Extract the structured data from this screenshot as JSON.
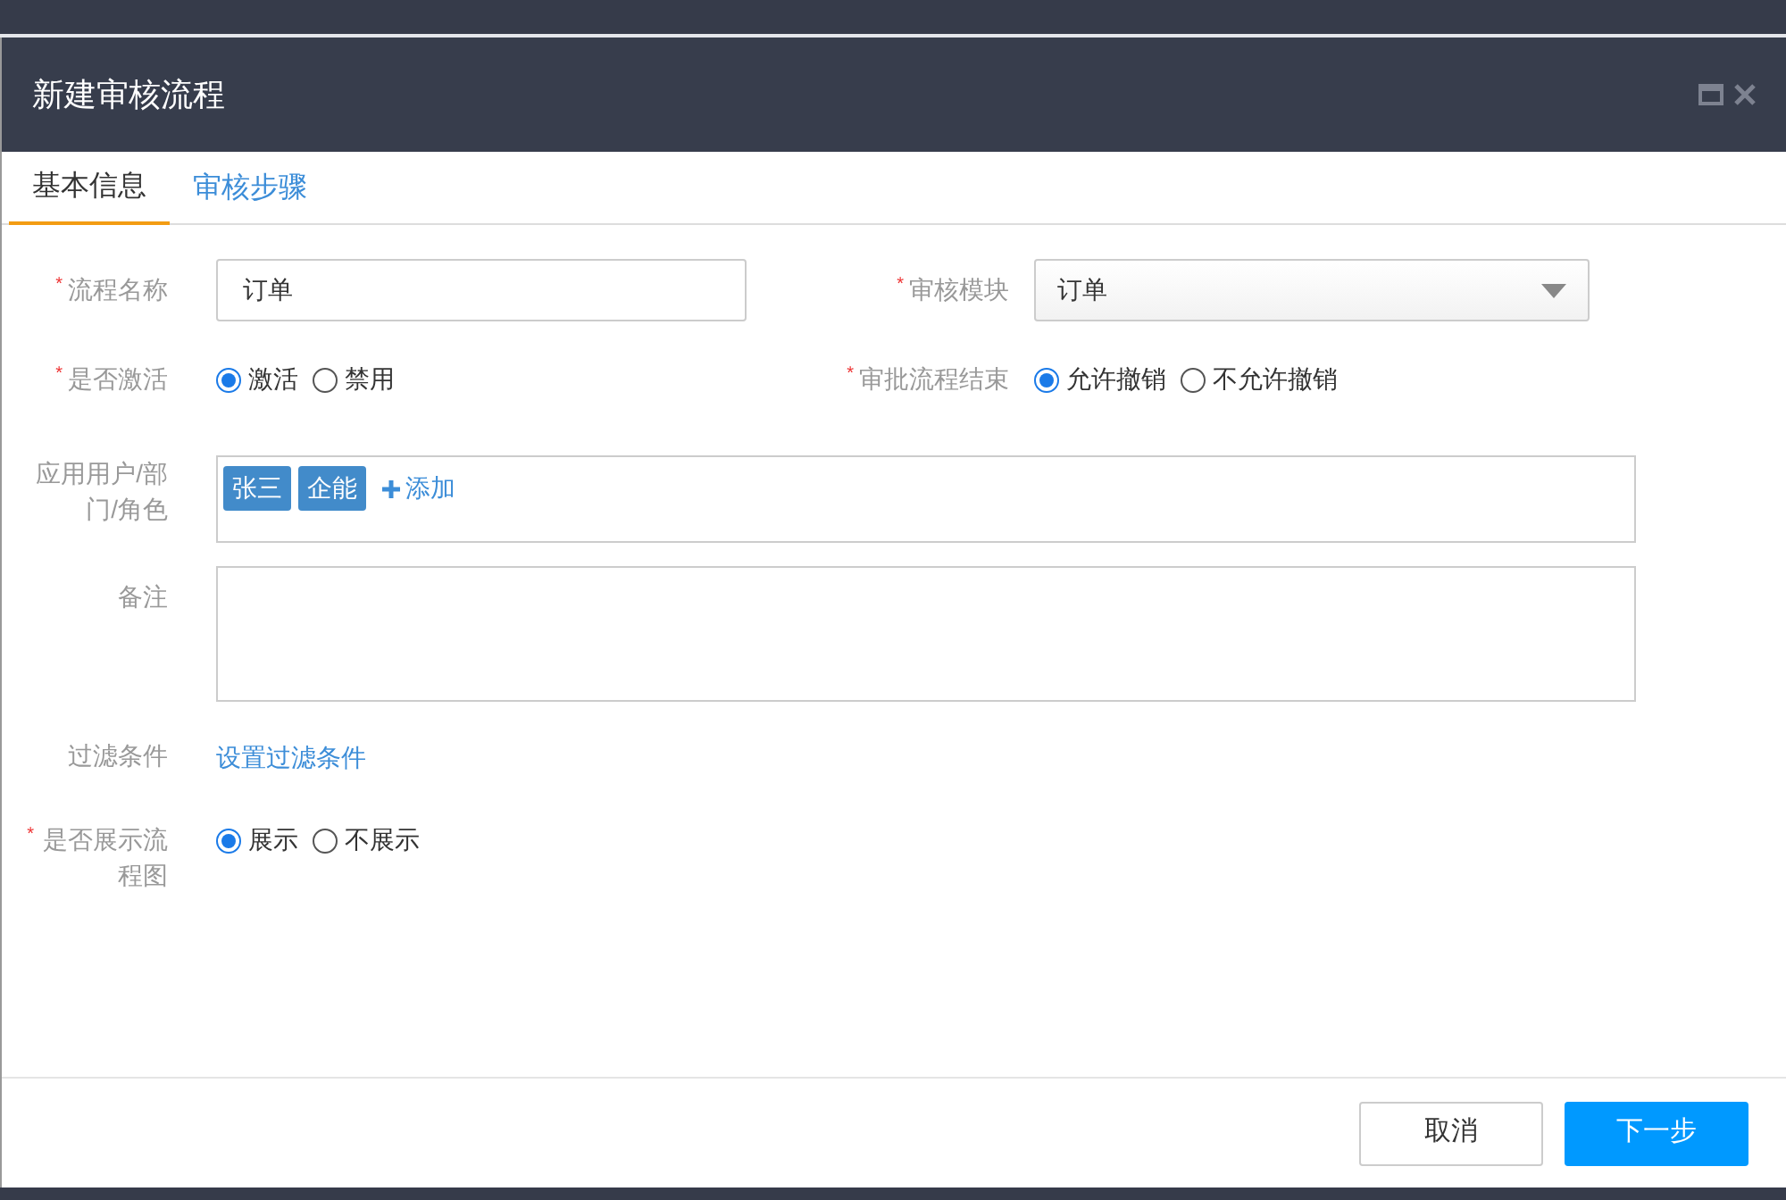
{
  "dialog": {
    "title": "新建审核流程"
  },
  "tabs": [
    {
      "label": "基本信息",
      "selected": true
    },
    {
      "label": "审核步骤",
      "selected": false
    }
  ],
  "form": {
    "name": {
      "label": "流程名称",
      "required_mark": "*",
      "value": "订单"
    },
    "module": {
      "label": "审核模块",
      "required_mark": "*",
      "value": "订单"
    },
    "active": {
      "label": "是否激活",
      "required_mark": "*",
      "options": [
        {
          "label": "激活",
          "selected": true
        },
        {
          "label": "禁用",
          "selected": false
        }
      ]
    },
    "end": {
      "label": "审批流程结束",
      "required_mark": "*",
      "options": [
        {
          "label": "允许撤销",
          "selected": true
        },
        {
          "label": "不允许撤销",
          "selected": false
        }
      ]
    },
    "users": {
      "label": "应用用户/部门/角色",
      "tags": [
        "张三",
        "企能"
      ],
      "add": "添加"
    },
    "note": {
      "label": "备注"
    },
    "filter": {
      "label": "过滤条件",
      "link": "设置过滤条件"
    },
    "chart": {
      "label": "是否展示流程图",
      "required_mark": "*",
      "options": [
        {
          "label": "展示",
          "selected": true
        },
        {
          "label": "不展示",
          "selected": false
        }
      ]
    }
  },
  "buttons": {
    "cancel": "取消",
    "next": "下一步"
  }
}
